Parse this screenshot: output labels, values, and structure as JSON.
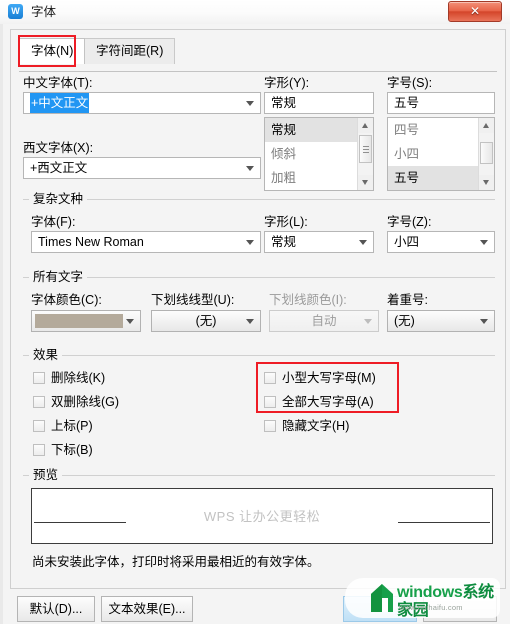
{
  "window": {
    "title": "字体",
    "app_icon": "wps-writer-icon",
    "close_label": "✕"
  },
  "tabs": [
    {
      "label": "字体(N)",
      "accel": "N",
      "active": true
    },
    {
      "label": "字符间距(R)",
      "accel": "R",
      "active": false
    }
  ],
  "latin_section": {
    "chinese_font_label": "中文字体(T):",
    "chinese_font_value": "+中文正文",
    "western_font_label": "西文字体(X):",
    "western_font_value": "+西文正文",
    "style_label": "字形(Y):",
    "style_value": "常规",
    "style_options": [
      "常规",
      "倾斜",
      "加粗"
    ],
    "style_selected_index": 0,
    "size_label": "字号(S):",
    "size_value": "五号",
    "size_options": [
      "四号",
      "小四",
      "五号"
    ],
    "size_selected_index": 2
  },
  "complex_section": {
    "caption": "复杂文种",
    "font_label": "字体(F):",
    "font_value": "Times New Roman",
    "style_label": "字形(L):",
    "style_value": "常规",
    "size_label": "字号(Z):",
    "size_value": "小四"
  },
  "alltext_section": {
    "caption": "所有文字",
    "color_label": "字体颜色(C):",
    "color_value": "#b4aa9b",
    "underline_style_label": "下划线线型(U):",
    "underline_style_value": "(无)",
    "underline_color_label": "下划线颜色(I):",
    "underline_color_value": "自动",
    "underline_color_disabled": true,
    "emphasis_label": "着重号:",
    "emphasis_value": "(无)"
  },
  "effects_section": {
    "caption": "效果",
    "left_items": [
      {
        "label": "删除线(K)",
        "checked": false
      },
      {
        "label": "双删除线(G)",
        "checked": false
      },
      {
        "label": "上标(P)",
        "checked": false
      },
      {
        "label": "下标(B)",
        "checked": false
      }
    ],
    "right_items": [
      {
        "label": "小型大写字母(M)",
        "checked": false
      },
      {
        "label": "全部大写字母(A)",
        "checked": false
      },
      {
        "label": "隐藏文字(H)",
        "checked": false
      }
    ]
  },
  "preview_section": {
    "caption": "预览",
    "sample_text": "WPS 让办公更轻松",
    "note": "尚未安装此字体，打印时将采用最相近的有效字体。"
  },
  "footer": {
    "default_button": "默认(D)...",
    "texteffect_button": "文本效果(E)..."
  },
  "watermark": {
    "brand": "windows",
    "brand_cn": "系统家园",
    "url": "www.nuihaifu.com"
  },
  "annotations": {
    "tab_highlight": "red-box-font-tab",
    "caps_highlight": "red-box-capital-letters"
  },
  "colors": {
    "accent_red": "#ee1c25",
    "selection_blue": "#2196f3",
    "dialog_bg": "#f4f4f4"
  }
}
